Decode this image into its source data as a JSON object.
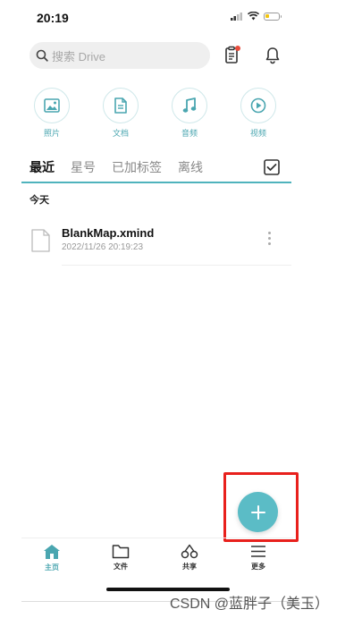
{
  "status_bar": {
    "time": "20:19"
  },
  "search": {
    "placeholder": "搜索 Drive"
  },
  "categories": [
    {
      "label": "照片",
      "icon": "image-icon"
    },
    {
      "label": "文档",
      "icon": "document-icon"
    },
    {
      "label": "音频",
      "icon": "music-icon"
    },
    {
      "label": "视频",
      "icon": "play-icon"
    }
  ],
  "tabs": [
    {
      "label": "最近",
      "active": true
    },
    {
      "label": "星号",
      "active": false
    },
    {
      "label": "已加标签",
      "active": false
    },
    {
      "label": "离线",
      "active": false
    }
  ],
  "section_title": "今天",
  "files": [
    {
      "name": "BlankMap.xmind",
      "date": "2022/11/26 20:19:23"
    }
  ],
  "bottom_nav": [
    {
      "label": "主页",
      "active": true
    },
    {
      "label": "文件",
      "active": false
    },
    {
      "label": "共享",
      "active": false
    },
    {
      "label": "更多",
      "active": false
    }
  ],
  "watermark": "CSDN @蓝胖子（美玉）",
  "colors": {
    "accent": "#5bbcc6",
    "highlight": "#e8201c",
    "notification": "#e74c3c"
  }
}
